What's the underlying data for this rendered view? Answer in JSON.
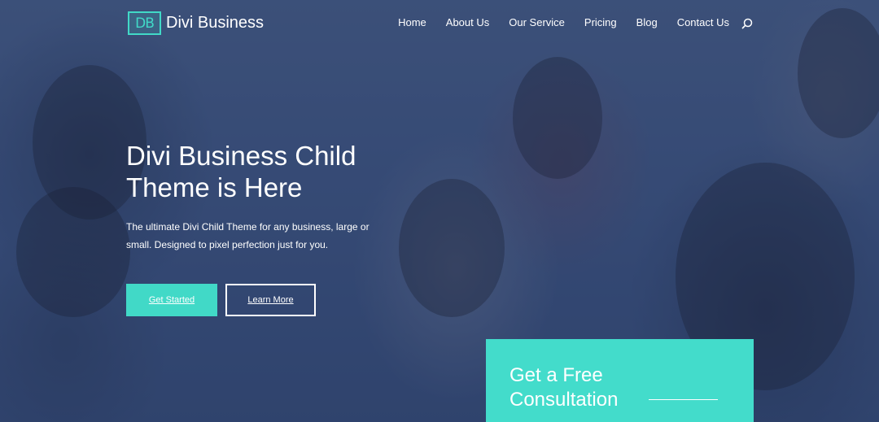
{
  "brand": {
    "logo_mark": "DB",
    "name": "Divi Business",
    "accent": "#41d9c7"
  },
  "nav": {
    "items": [
      "Home",
      "About Us",
      "Our Service",
      "Pricing",
      "Blog",
      "Contact Us"
    ],
    "search_icon": "search-icon"
  },
  "hero": {
    "title_line1": "Divi Business Child",
    "title_line2": "Theme is Here",
    "subtitle_line1": "The ultimate Divi Child Theme for any business, large or",
    "subtitle_line2": "small. Designed to pixel perfection just for you.",
    "primary_button": "Get Started",
    "secondary_button": "Learn More"
  },
  "consultation_card": {
    "title_line1": "Get a Free",
    "title_line2": "Consultation",
    "background": "#43dccb"
  }
}
